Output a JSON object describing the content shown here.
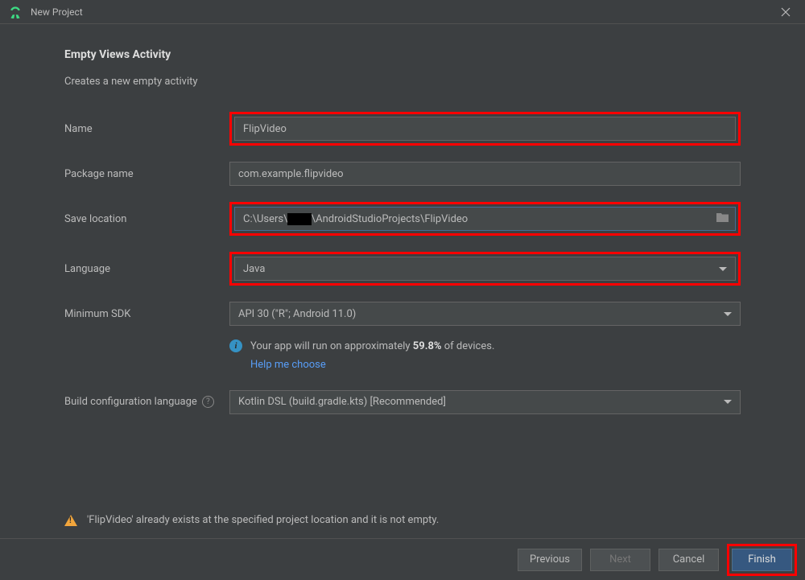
{
  "window": {
    "title": "New Project"
  },
  "header": {
    "title": "Empty Views Activity",
    "subtitle": "Creates a new empty activity"
  },
  "labels": {
    "name": "Name",
    "package": "Package name",
    "location": "Save location",
    "language": "Language",
    "minsdk": "Minimum SDK",
    "buildlang": "Build configuration language"
  },
  "fields": {
    "name": "FlipVideo",
    "package": "com.example.flipvideo",
    "location_pre": "C:\\Users\\",
    "location_redacted": "_____",
    "location_post": "\\AndroidStudioProjects\\FlipVideo",
    "language": "Java",
    "minsdk": "API 30 (\"R\"; Android 11.0)",
    "buildlang": "Kotlin DSL (build.gradle.kts) [Recommended]"
  },
  "info": {
    "text_pre": "Your app will run on approximately ",
    "percent": "59.8%",
    "text_post": " of devices.",
    "help_link": "Help me choose"
  },
  "warning": "'FlipVideo' already exists at the specified project location and it is not empty.",
  "buttons": {
    "previous": "Previous",
    "next": "Next",
    "cancel": "Cancel",
    "finish": "Finish"
  },
  "highlight_color": "#ff0000"
}
